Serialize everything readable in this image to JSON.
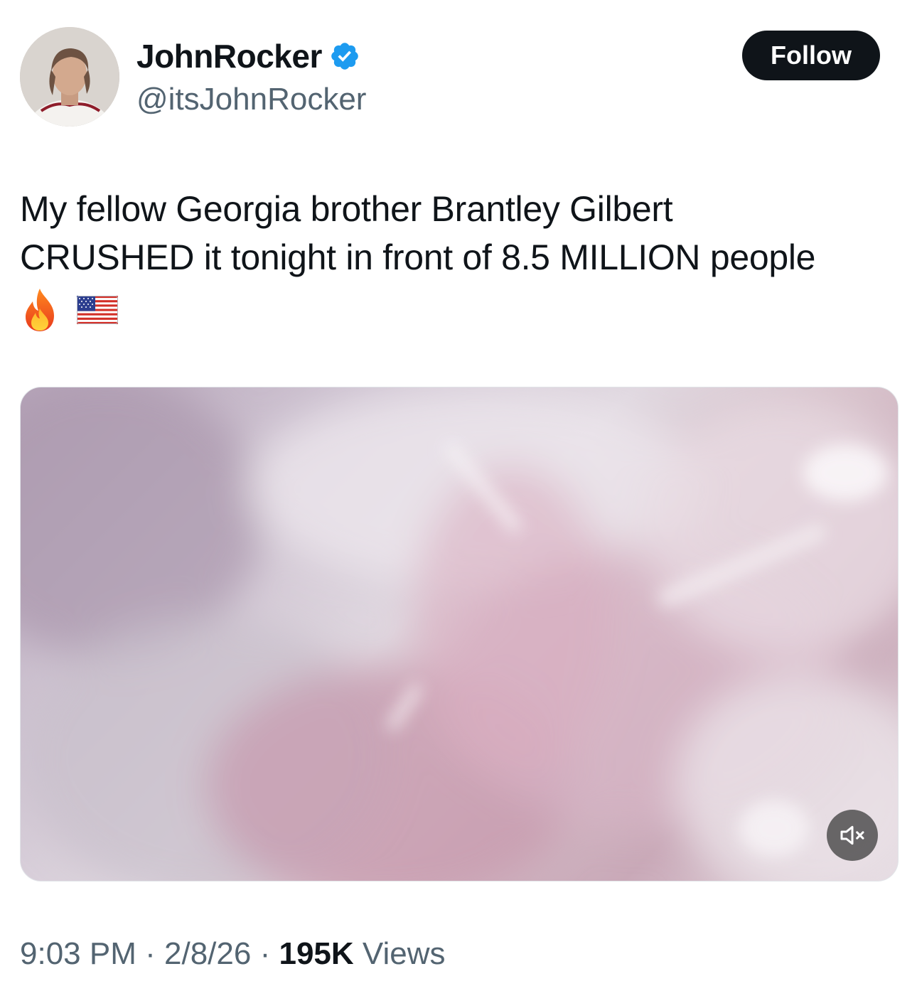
{
  "author": {
    "display_name": "JohnRocker",
    "handle": "@itsJohnRocker",
    "verified": true
  },
  "follow_button": {
    "label": "Follow"
  },
  "tweet": {
    "text_lines": [
      "My fellow Georgia brother Brantley Gilbert",
      "CRUSHED it tonight in front of 8.5 MILLION people"
    ],
    "emojis": [
      "fire-emoji",
      "us-flag-emoji"
    ]
  },
  "media": {
    "type": "video",
    "muted": true
  },
  "meta": {
    "time": "9:03 PM",
    "separator": "·",
    "date": "2/8/26",
    "views_count": "195K",
    "views_label": "Views"
  },
  "colors": {
    "text_primary": "#0f1419",
    "text_secondary": "#536471",
    "verified_blue": "#1d9bf0",
    "follow_bg": "#0f1419"
  }
}
